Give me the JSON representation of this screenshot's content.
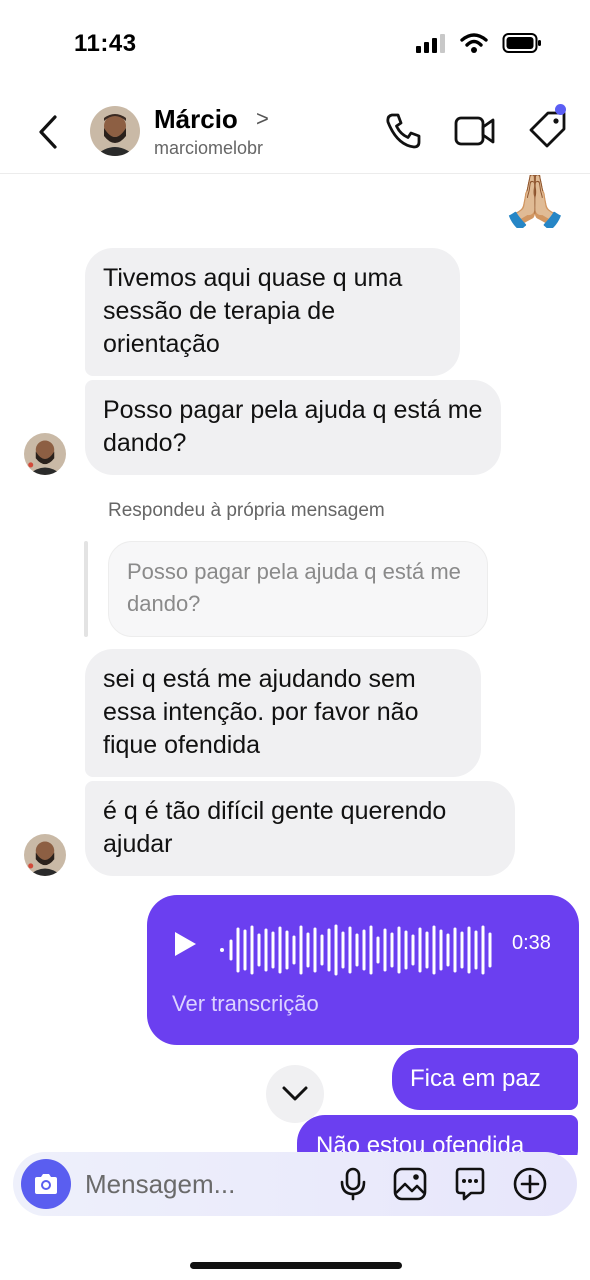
{
  "status_bar": {
    "time": "11:43"
  },
  "header": {
    "contact_name": "Márcio",
    "chevron": ">",
    "contact_handle": "marciomelobr"
  },
  "messages": {
    "emoji": "🙏🏼",
    "m1": "Tivemos aqui quase q uma sessão de terapia de orientação",
    "m2": "Posso pagar pela ajuda q está me dando?",
    "reply_note": "Respondeu à própria mensagem",
    "quoted": "Posso pagar pela ajuda q está me dando?",
    "m3": "sei q está me ajudando sem essa intenção. por favor não fique ofendida",
    "m4": "é q é tão difícil gente querendo ajudar",
    "voice_duration": "0:38",
    "voice_transcription": "Ver transcrição",
    "out1": "Fica em paz",
    "out2": "Não estou ofendida"
  },
  "composer": {
    "placeholder": "Mensagem..."
  },
  "colors": {
    "accent_purple": "#6b3ff0",
    "camera_blue": "#5a5ef0",
    "incoming_bubble": "#f0f0f2",
    "notification_dot": "#5b5ef4"
  },
  "icons": {
    "back": "chevron-left-icon",
    "call": "phone-icon",
    "video": "video-camera-icon",
    "tag": "tag-icon",
    "play": "play-icon",
    "scroll": "chevron-down-icon",
    "camera": "camera-icon",
    "mic": "microphone-icon",
    "gallery": "image-icon",
    "sticker": "chat-bubble-icon",
    "add": "plus-circle-icon"
  }
}
